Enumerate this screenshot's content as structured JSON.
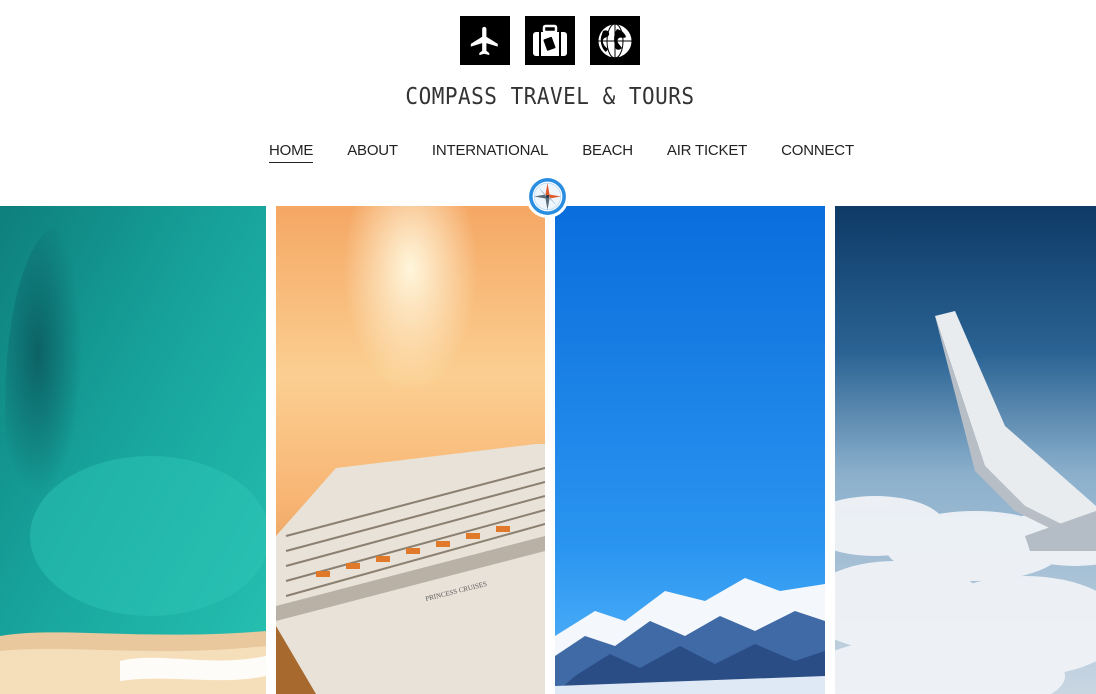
{
  "brand": {
    "name": "COMPASS TRAVEL & TOURS",
    "icons": [
      "airplane-icon",
      "luggage-icon",
      "globe-icon"
    ]
  },
  "nav": {
    "items": [
      "HOME",
      "ABOUT",
      "INTERNATIONAL",
      "BEACH",
      "AIR TICKET",
      "CONNECT"
    ],
    "active": "HOME"
  },
  "badge": {
    "icon": "compass-icon",
    "color": "#2a8ee0"
  },
  "gallery": {
    "panels": [
      {
        "subject": "aerial-beach",
        "colors": [
          "#1aa39a",
          "#e9c89e"
        ]
      },
      {
        "subject": "cruise-ship-sunset",
        "ship_text": "PRINCESS CRUISES",
        "colors": [
          "#f6a35a",
          "#ffe3b0"
        ]
      },
      {
        "subject": "snow-mountains",
        "colors": [
          "#0a6ee0",
          "#3ba7f5"
        ]
      },
      {
        "subject": "airplane-wing-clouds",
        "colors": [
          "#1d4e7c",
          "#e9eef3"
        ]
      }
    ]
  }
}
